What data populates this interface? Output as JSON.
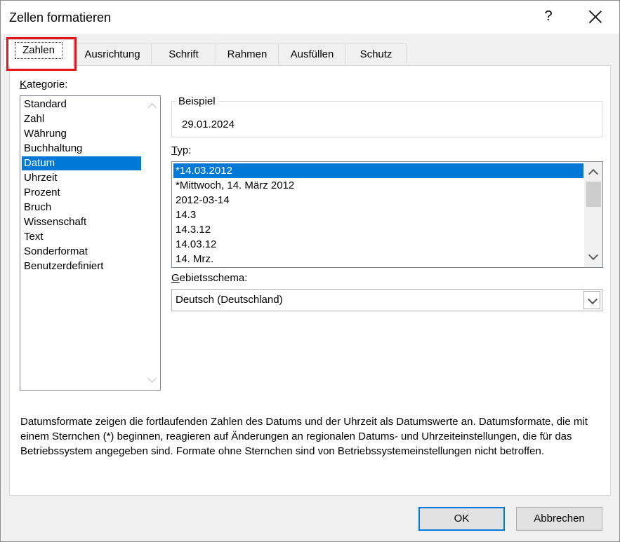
{
  "window": {
    "title": "Zellen formatieren",
    "help": "?"
  },
  "tabs": [
    "Zahlen",
    "Ausrichtung",
    "Schrift",
    "Rahmen",
    "Ausfüllen",
    "Schutz"
  ],
  "category": {
    "label": "Kategorie:",
    "items": [
      "Standard",
      "Zahl",
      "Währung",
      "Buchhaltung",
      "Datum",
      "Uhrzeit",
      "Prozent",
      "Bruch",
      "Wissenschaft",
      "Text",
      "Sonderformat",
      "Benutzerdefiniert"
    ],
    "selected": "Datum"
  },
  "sample": {
    "label": "Beispiel",
    "value": "29.01.2024"
  },
  "type": {
    "label": "Typ:",
    "items": [
      "*14.03.2012",
      "*Mittwoch, 14. März 2012",
      "2012-03-14",
      "14.3",
      "14.3.12",
      "14.03.12",
      "14. Mrz."
    ],
    "selected": "*14.03.2012"
  },
  "locale": {
    "label": "Gebietsschema:",
    "value": "Deutsch (Deutschland)"
  },
  "description": "Datumsformate zeigen die fortlaufenden Zahlen des Datums und der Uhrzeit als Datumswerte an. Datumsformate, die mit einem Sternchen (*) beginnen, reagieren auf Änderungen an regionalen Datums- und Uhrzeiteinstellungen, die für das Betriebssystem angegeben sind. Formate ohne Sternchen sind von Betriebssystemeinstellungen nicht betroffen.",
  "buttons": {
    "ok": "OK",
    "cancel": "Abbrechen"
  },
  "colors": {
    "selection": "#0078d7",
    "highlight_box": "#e3141a"
  }
}
